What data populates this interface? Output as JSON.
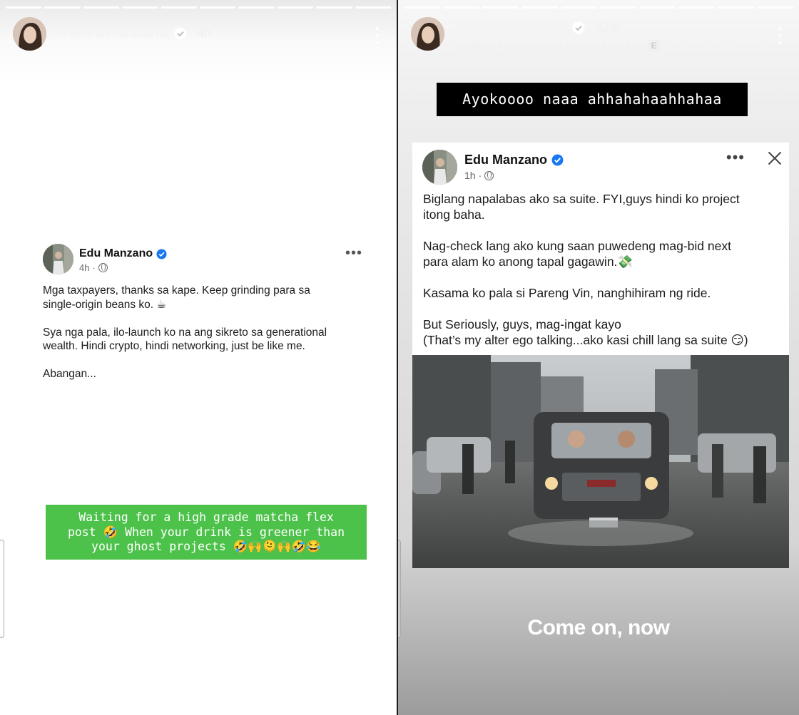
{
  "left_story": {
    "username": "maria.elena.adarna",
    "time": "4h",
    "progress_segments": 10,
    "post": {
      "author": "Edu Manzano",
      "time": "4h",
      "paragraphs": [
        "Mga taxpayers, thanks sa kape. Keep grinding para sa\nsingle-origin beans ko. ☕",
        "Sya nga pala, ilo-launch ko na ang sikreto sa generational\nwealth. Hindi crypto, hindi networking, just be like me.",
        "Abangan..."
      ],
      "more_icon": "ellipsis-icon"
    },
    "sticker_text": "Waiting for a high grade matcha flex\npost 🤣 When your drink is greener than\nyour ghost projects 🤣🙌🫠🙌🤣😂"
  },
  "right_story": {
    "username": "maria.elena.adarna",
    "time": "42m",
    "music": "Nelly • Ride Wit Me (feat. City Spud)",
    "explicit": "E",
    "progress_segments": 10,
    "caption": "Ayokoooo naaa ahhahahaahhahaa",
    "post": {
      "author": "Edu Manzano",
      "time": "1h",
      "paragraphs": [
        "Biglang napalabas ako sa suite. FYI,guys hindi ko project\nitong baha.",
        "Nag-check lang ako kung saan puwedeng mag-bid next\npara alam ko anong tapal gagawin.💸",
        "Kasama ko pala si Pareng Vin,  nanghihiram ng ride.",
        "But Seriously, guys, mag-ingat kayo\n(That’s my alter ego talking...ako kasi chill lang sa suite 😏)"
      ]
    },
    "footer_text": "Come on, now"
  },
  "colors": {
    "sticker_green": "#4dc24a",
    "verified_blue": "#1877f2",
    "caption_bg": "#000000"
  }
}
